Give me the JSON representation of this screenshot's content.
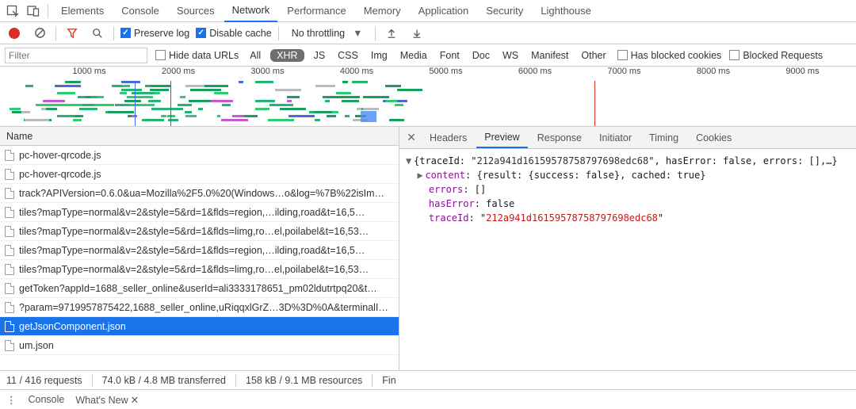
{
  "main_tabs": {
    "elements": "Elements",
    "console": "Console",
    "sources": "Sources",
    "network": "Network",
    "performance": "Performance",
    "memory": "Memory",
    "application": "Application",
    "security": "Security",
    "lighthouse": "Lighthouse"
  },
  "toolbar": {
    "preserve_log": "Preserve log",
    "disable_cache": "Disable cache",
    "throttling": "No throttling"
  },
  "filter": {
    "placeholder": "Filter",
    "hide_data_urls": "Hide data URLs",
    "types": {
      "all": "All",
      "xhr": "XHR",
      "js": "JS",
      "css": "CSS",
      "img": "Img",
      "media": "Media",
      "font": "Font",
      "doc": "Doc",
      "ws": "WS",
      "manifest": "Manifest",
      "other": "Other"
    },
    "has_blocked_cookies": "Has blocked cookies",
    "blocked_requests": "Blocked Requests"
  },
  "timeline": {
    "ticks": [
      "1000 ms",
      "2000 ms",
      "3000 ms",
      "4000 ms",
      "5000 ms",
      "6000 ms",
      "7000 ms",
      "8000 ms",
      "9000 ms"
    ]
  },
  "columns": {
    "name": "Name"
  },
  "requests": [
    {
      "name": "pc-hover-qrcode.js",
      "selected": false
    },
    {
      "name": "pc-hover-qrcode.js",
      "selected": false
    },
    {
      "name": "track?APIVersion=0.6.0&ua=Mozilla%2F5.0%20(Windows…o&log=%7B%22isIm…",
      "selected": false
    },
    {
      "name": "tiles?mapType=normal&v=2&style=5&rd=1&flds=region,…ilding,road&t=16,5…",
      "selected": false
    },
    {
      "name": "tiles?mapType=normal&v=2&style=5&rd=1&flds=limg,ro…el,poilabel&t=16,53…",
      "selected": false
    },
    {
      "name": "tiles?mapType=normal&v=2&style=5&rd=1&flds=region,…ilding,road&t=16,5…",
      "selected": false
    },
    {
      "name": "tiles?mapType=normal&v=2&style=5&rd=1&flds=limg,ro…el,poilabel&t=16,53…",
      "selected": false
    },
    {
      "name": "getToken?appId=1688_seller_online&userId=ali3333178651_pm02ldutrtpq20&t…",
      "selected": false
    },
    {
      "name": "?param=9719957875422,1688_seller_online,uRiqqxlGrZ…3D%3D%0A&terminalI…",
      "selected": false
    },
    {
      "name": "getJsonComponent.json",
      "selected": true
    },
    {
      "name": "um.json",
      "selected": false
    }
  ],
  "right_tabs": {
    "headers": "Headers",
    "preview": "Preview",
    "response": "Response",
    "initiator": "Initiator",
    "timing": "Timing",
    "cookies": "Cookies"
  },
  "preview": {
    "line1_pre": "{traceId: \"",
    "line1_trace": "212a941d16159578758797698edc68",
    "line1_post": "\", hasError: false, errors: [],…}",
    "content_key": "content",
    "content_val": ": {result: {success: false}, cached: true}",
    "errors_key": "errors",
    "errors_val": ": []",
    "haserror_key": "hasError",
    "haserror_val": ": false",
    "traceid_key": "traceId",
    "traceid_sep": ": \"",
    "traceid_val": "212a941d16159578758797698edc68",
    "traceid_end": "\""
  },
  "status": {
    "requests": "11 / 416 requests",
    "transferred": "74.0 kB / 4.8 MB transferred",
    "resources": "158 kB / 9.1 MB resources",
    "finish": "Fin"
  },
  "drawer": {
    "console": "Console",
    "whats_new": "What's New"
  }
}
